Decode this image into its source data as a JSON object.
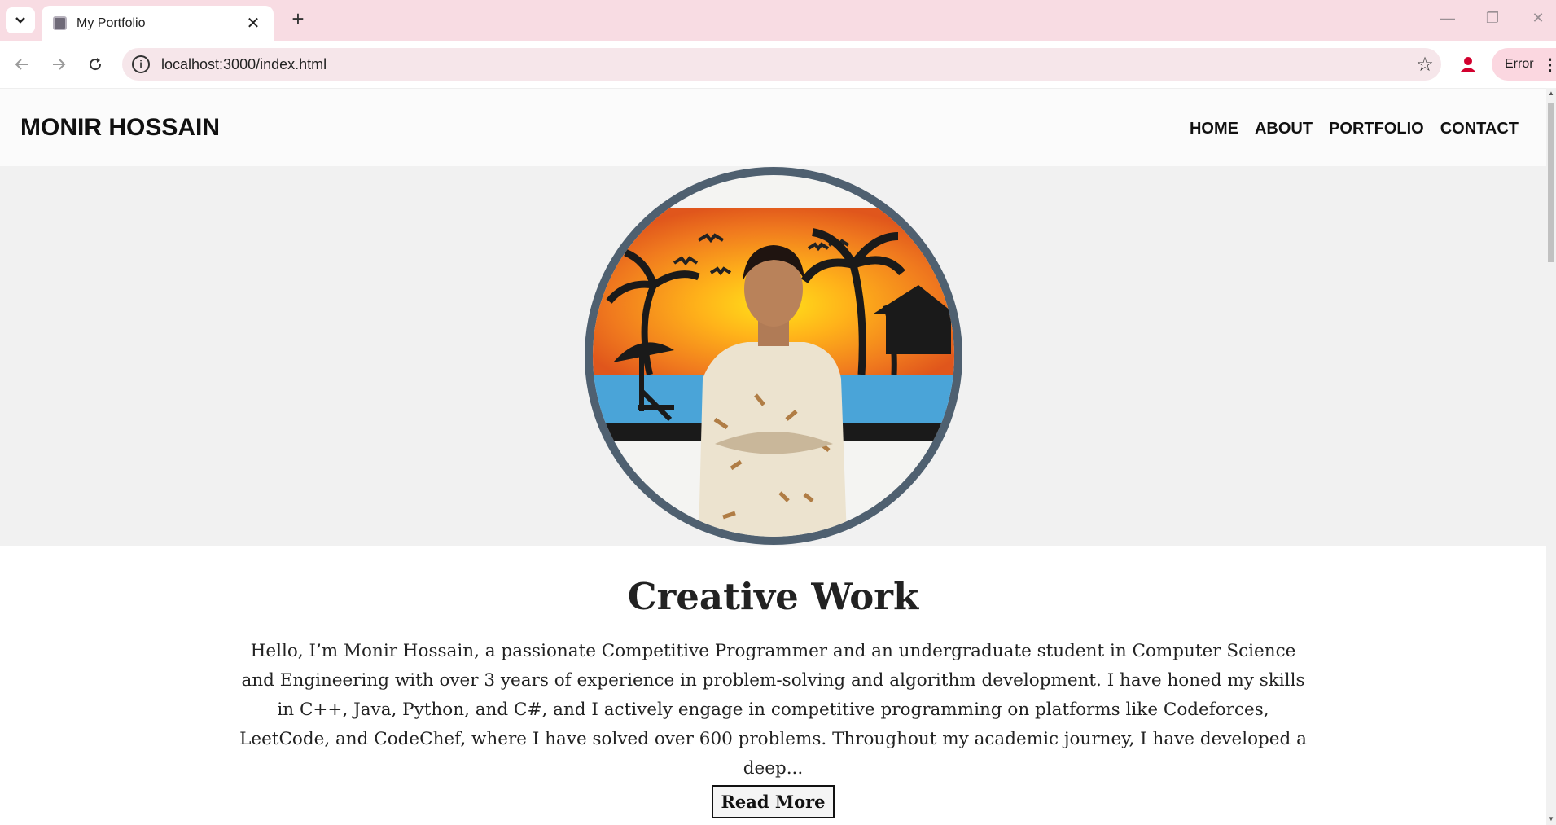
{
  "browser": {
    "tab_title": "My Portfolio",
    "url": "localhost:3000/index.html",
    "profile_status": "Error"
  },
  "site": {
    "logo": "MONIR HOSSAIN",
    "nav": [
      "HOME",
      "ABOUT",
      "PORTFOLIO",
      "CONTACT"
    ],
    "heading_light": "Creative ",
    "heading_bold": "Work",
    "bio": "Hello, I’m Monir Hossain, a passionate Competitive Programmer and an undergraduate student in Computer Science and Engineering with over 3 years of experience in problem-solving and algorithm development. I have honed my skills in C++, Java, Python, and C#, and I actively engage in competitive programming on platforms like Codeforces, LeetCode, and CodeChef, where I have solved over 600 problems. Throughout my academic journey, I have developed a deep...",
    "read_more": "Read More"
  },
  "colors": {
    "tabbar_bg": "#f8dce3",
    "avatar_ring": "#4f6070",
    "hero_bg": "#f1f1f1"
  }
}
